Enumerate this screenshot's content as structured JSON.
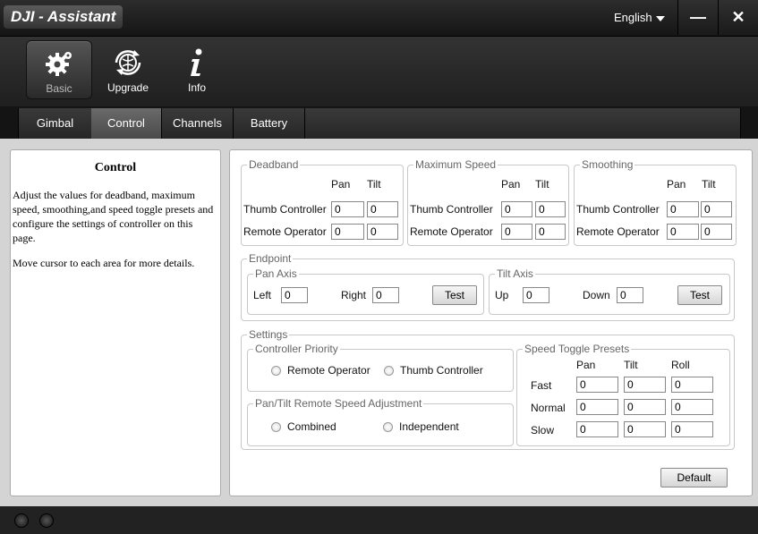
{
  "app": {
    "title": "DJI - Assistant",
    "language": "English",
    "minimize_symbol": "—",
    "close_symbol": "✕"
  },
  "toolbar": [
    {
      "label": "Basic",
      "icon": "gear-icon",
      "active": true
    },
    {
      "label": "Upgrade",
      "icon": "upgrade-globe-icon",
      "active": false
    },
    {
      "label": "Info",
      "icon": "info-icon",
      "active": false
    }
  ],
  "tabs": [
    {
      "label": "Gimbal",
      "active": false
    },
    {
      "label": "Control",
      "active": true
    },
    {
      "label": "Channels",
      "active": false
    },
    {
      "label": "Battery",
      "active": false
    }
  ],
  "help": {
    "title": "Control",
    "p1": "Adjust the values for deadband, maximum speed, smoothing,and speed toggle presets and configure the settings of controller on this page.",
    "p2": "Move cursor to each area for more details."
  },
  "deadband": {
    "legend": "Deadband",
    "col_pan": "Pan",
    "col_tilt": "Tilt",
    "row1_label": "Thumb Controller",
    "row1_pan": "0",
    "row1_tilt": "0",
    "row2_label": "Remote Operator",
    "row2_pan": "0",
    "row2_tilt": "0"
  },
  "max_speed": {
    "legend": "Maximum Speed",
    "col_pan": "Pan",
    "col_tilt": "Tilt",
    "row1_label": "Thumb Controller",
    "row1_pan": "0",
    "row1_tilt": "0",
    "row2_label": "Remote Operator",
    "row2_pan": "0",
    "row2_tilt": "0"
  },
  "smoothing": {
    "legend": "Smoothing",
    "col_pan": "Pan",
    "col_tilt": "Tilt",
    "row1_label": "Thumb Controller",
    "row1_pan": "0",
    "row1_tilt": "0",
    "row2_label": "Remote Operator",
    "row2_pan": "0",
    "row2_tilt": "0"
  },
  "endpoint": {
    "legend": "Endpoint",
    "pan_legend": "Pan Axis",
    "left_label": "Left",
    "left_value": "0",
    "right_label": "Right",
    "right_value": "0",
    "pan_test": "Test",
    "tilt_legend": "Tilt Axis",
    "up_label": "Up",
    "up_value": "0",
    "down_label": "Down",
    "down_value": "0",
    "tilt_test": "Test"
  },
  "settings": {
    "legend": "Settings",
    "priority_legend": "Controller Priority",
    "priority_opt1": "Remote Operator",
    "priority_opt2": "Thumb Controller",
    "speed_adj_legend": "Pan/Tilt Remote Speed Adjustment",
    "speed_adj_opt1": "Combined",
    "speed_adj_opt2": "Independent",
    "presets_legend": "Speed Toggle Presets",
    "col_pan": "Pan",
    "col_tilt": "Tilt",
    "col_roll": "Roll",
    "fast_label": "Fast",
    "fast_pan": "0",
    "fast_tilt": "0",
    "fast_roll": "0",
    "normal_label": "Normal",
    "normal_pan": "0",
    "normal_tilt": "0",
    "normal_roll": "0",
    "slow_label": "Slow",
    "slow_pan": "0",
    "slow_tilt": "0",
    "slow_roll": "0"
  },
  "default_button": "Default"
}
